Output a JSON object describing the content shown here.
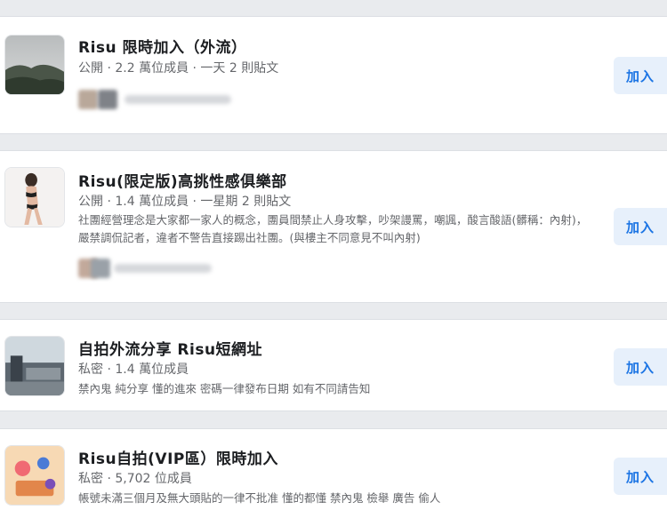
{
  "groups": [
    {
      "name": "Risu 限時加入（外流）",
      "meta": "公開 · 2.2 萬位成員 · 一天 2 則貼文",
      "description": "",
      "join_label": "加入"
    },
    {
      "name": "Risu(限定版)高挑性感俱樂部",
      "meta": "公開 · 1.4 萬位成員 · 一星期 2 則貼文",
      "description": "社團經營理念是大家都一家人的概念，團員間禁止人身攻擊，吵架謾罵，嘲諷，酸言酸語(髒稱：內射)，嚴禁調侃記者，違者不警告直接踢出社團。(與樓主不同意見不叫內射)",
      "join_label": "加入"
    },
    {
      "name": "自拍外流分享 Risu短網址",
      "meta": "私密 · 1.4 萬位成員",
      "description": "禁內鬼 純分享 懂的進來 密碼一律發布日期 如有不同請告知",
      "join_label": "加入"
    },
    {
      "name": "Risu自拍(VIP區）限時加入",
      "meta": "私密 · 5,702 位成員",
      "description": "帳號未滿三個月及無大頭貼的一律不批准 懂的都懂 禁內鬼 檢舉 廣告 偷人",
      "join_label": "加入"
    }
  ]
}
